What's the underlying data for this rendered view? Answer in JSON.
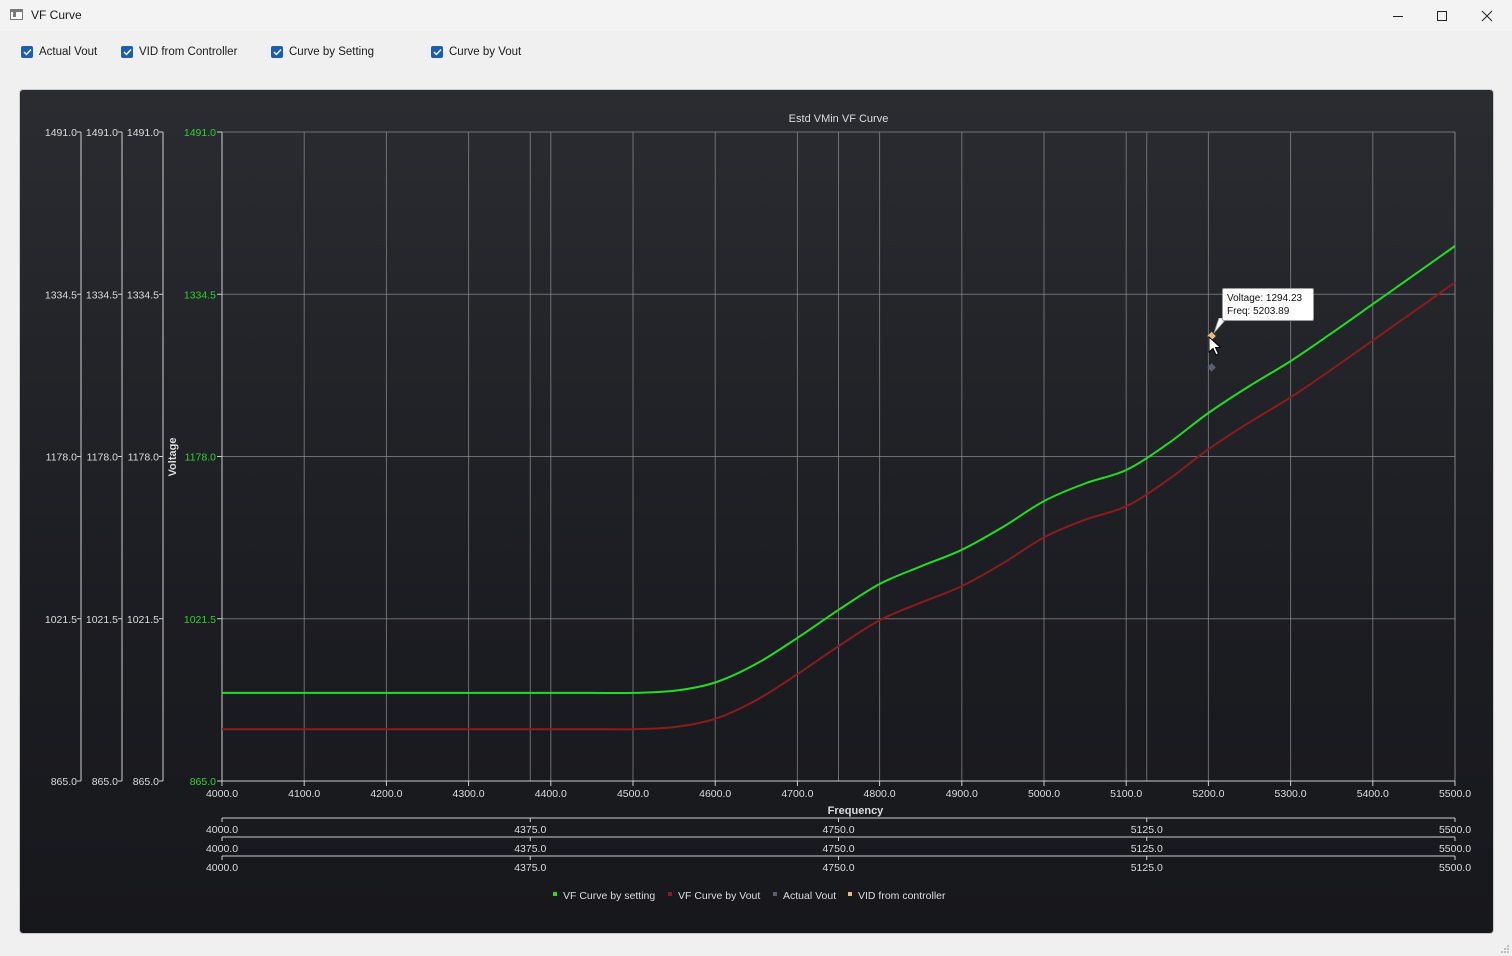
{
  "window": {
    "title": "VF Curve",
    "icons": [
      "app-icon",
      "minimize-icon",
      "maximize-icon",
      "close-icon"
    ]
  },
  "toolbar": {
    "checkboxes": [
      {
        "label": "Actual Vout",
        "checked": true
      },
      {
        "label": "VID from Controller",
        "checked": true
      },
      {
        "label": "Curve by Setting",
        "checked": true
      },
      {
        "label": "Curve by Vout",
        "checked": true
      }
    ]
  },
  "colors": {
    "accent_checkbox": "#1b5eb4",
    "curve_setting": "#22dd22",
    "curve_vout": "#8b1c1c",
    "actual_vout": "#5a5f70",
    "vid_controller": "#f0b878",
    "axis_text": "#dcdcdc",
    "axis_green": "#2fd12f",
    "grid": "#8a8a8a"
  },
  "tooltip": {
    "voltage_line": "Voltage: 1294.23",
    "freq_line": "Freq: 5203.89"
  },
  "chart_data": {
    "type": "line",
    "title": "Estd VMin VF Curve",
    "xlabel": "Frequency",
    "ylabel": "Voltage",
    "xlim": [
      4000.0,
      5500.0
    ],
    "ylim": [
      865.0,
      1491.0
    ],
    "grid": true,
    "legend_position": "bottom-center",
    "x_ticks": [
      "4000.0",
      "4100.0",
      "4200.0",
      "4300.0",
      "4400.0",
      "4500.0",
      "4600.0",
      "4700.0",
      "4800.0",
      "4900.0",
      "5000.0",
      "5100.0",
      "5200.0",
      "5300.0",
      "5400.0",
      "5500.0"
    ],
    "y_ticks": [
      "865.0",
      "1021.5",
      "1178.0",
      "1334.5",
      "1491.0"
    ],
    "secondary_x_axes": [
      [
        "4000.0",
        "4375.0",
        "4750.0",
        "5125.0",
        "5500.0"
      ],
      [
        "4000.0",
        "4375.0",
        "4750.0",
        "5125.0",
        "5500.0"
      ],
      [
        "4000.0",
        "4375.0",
        "4750.0",
        "5125.0",
        "5500.0"
      ]
    ],
    "secondary_y_axes": [
      [
        "865.0",
        "1021.5",
        "1178.0",
        "1334.5",
        "1491.0"
      ],
      [
        "865.0",
        "1021.5",
        "1178.0",
        "1334.5",
        "1491.0"
      ],
      [
        "865.0",
        "1021.5",
        "1178.0",
        "1334.5",
        "1491.0"
      ]
    ],
    "series": [
      {
        "name": "VF Curve by setting",
        "x": [
          4000,
          4100,
          4200,
          4300,
          4400,
          4450,
          4500,
          4550,
          4600,
          4650,
          4700,
          4750,
          4800,
          4850,
          4900,
          4950,
          5000,
          5050,
          5100,
          5150,
          5200,
          5250,
          5300,
          5350,
          5400,
          5450,
          5500
        ],
        "y": [
          950,
          950,
          950,
          950,
          950,
          950,
          950,
          952,
          960,
          978,
          1003,
          1030,
          1055,
          1072,
          1088,
          1110,
          1135,
          1152,
          1165,
          1190,
          1220,
          1246,
          1270,
          1297,
          1325,
          1353,
          1381
        ]
      },
      {
        "name": "VF Curve by Vout",
        "x": [
          4000,
          4100,
          4200,
          4300,
          4400,
          4450,
          4500,
          4550,
          4600,
          4650,
          4700,
          4750,
          4800,
          4850,
          4900,
          4950,
          5000,
          5050,
          5100,
          5150,
          5200,
          5250,
          5300,
          5350,
          5400,
          5450,
          5500
        ],
        "y": [
          915,
          915,
          915,
          915,
          915,
          915,
          915,
          917,
          925,
          943,
          968,
          995,
          1020,
          1037,
          1053,
          1075,
          1100,
          1117,
          1130,
          1155,
          1185,
          1211,
          1235,
          1262,
          1290,
          1318,
          1346
        ]
      },
      {
        "name": "Actual Vout",
        "x": [
          5203.89
        ],
        "y": [
          1264
        ]
      },
      {
        "name": "VID from controller",
        "x": [
          5203.89
        ],
        "y": [
          1294.23
        ]
      }
    ]
  }
}
